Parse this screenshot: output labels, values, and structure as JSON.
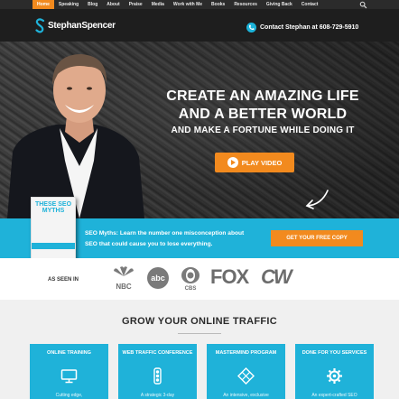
{
  "nav": {
    "items": [
      {
        "label": "Home"
      },
      {
        "label": "Speaking"
      },
      {
        "label": "Blog"
      },
      {
        "label": "About"
      },
      {
        "label": "Praise"
      },
      {
        "label": "Media"
      },
      {
        "label": "Work with Me"
      },
      {
        "label": "Books"
      },
      {
        "label": "Resources"
      },
      {
        "label": "Giving Back"
      },
      {
        "label": "Contact"
      }
    ],
    "active": "Home"
  },
  "header": {
    "logo_text": "StephanSpencer",
    "contact_text": "Contact Stephan at 608-729-5910"
  },
  "hero": {
    "line1": "CREATE AN AMAZING LIFE",
    "line2": "AND A BETTER WORLD",
    "line3": "AND MAKE A FORTUNE WHILE DOING IT",
    "play_label": "PLAY VIDEO"
  },
  "promo": {
    "book_title": "THESE SEO MYTHS",
    "text": "SEO Myths: Learn the number one misconception about SEO that could cause you to lose everything.",
    "cta_label": "GET YOUR FREE COPY"
  },
  "as_seen_in": {
    "label": "AS SEEN IN",
    "logos": {
      "nbc": "NBC",
      "abc": "abc",
      "cbs": "CBS",
      "fox": "FOX",
      "cw": "CW"
    }
  },
  "grow": {
    "title": "GROW YOUR ONLINE TRAFFIC",
    "cards": [
      {
        "title": "ONLINE TRAINING",
        "desc": "Cutting edge,",
        "icon": "monitor-icon"
      },
      {
        "title": "WEB TRAFFIC CONFERENCE",
        "desc": "A strategic 3-day",
        "icon": "traffic-light-icon"
      },
      {
        "title": "MASTERMIND PROGRAM",
        "desc": "An intensive, exclusive",
        "icon": "diamond-grid-icon"
      },
      {
        "title": "DONE FOR YOU SERVICES",
        "desc": "An expert-crafted SEO",
        "icon": "gear-icon"
      }
    ]
  },
  "colors": {
    "accent_orange": "#f28a1e",
    "accent_cyan": "#1fb2d9",
    "dark": "#1e1e1e"
  }
}
